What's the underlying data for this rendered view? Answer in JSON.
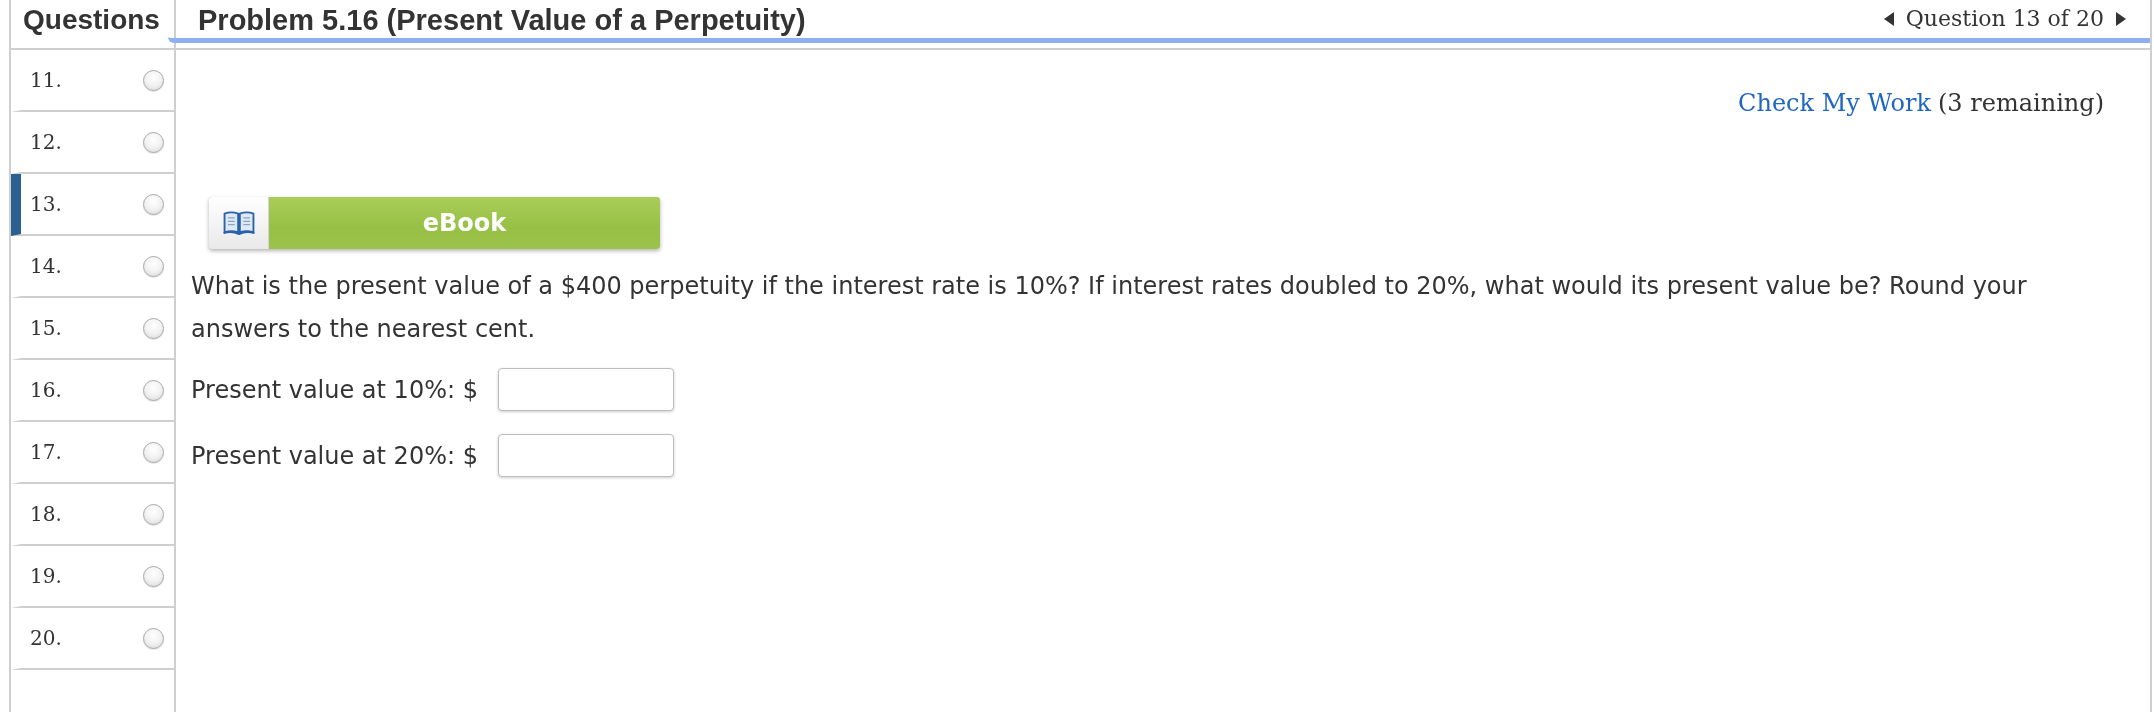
{
  "sidebar": {
    "title": "Questions",
    "items": [
      {
        "number": "11.",
        "selected": false
      },
      {
        "number": "12.",
        "selected": false
      },
      {
        "number": "13.",
        "selected": true
      },
      {
        "number": "14.",
        "selected": false
      },
      {
        "number": "15.",
        "selected": false
      },
      {
        "number": "16.",
        "selected": false
      },
      {
        "number": "17.",
        "selected": false
      },
      {
        "number": "18.",
        "selected": false
      },
      {
        "number": "19.",
        "selected": false
      },
      {
        "number": "20.",
        "selected": false
      }
    ]
  },
  "header": {
    "title": "Problem 5.16 (Present Value of a Perpetuity)",
    "pager": {
      "label": "Question 13 of 20"
    }
  },
  "check_work": {
    "link": "Check My Work",
    "remaining": "(3 remaining)"
  },
  "ebook": {
    "label": "eBook"
  },
  "question": {
    "text": "What is the present value of a $400 perpetuity if the interest rate is 10%? If interest rates doubled to 20%, what would its present value be? Round your answers to the nearest cent.",
    "fields": [
      {
        "label": "Present value at 10%: $"
      },
      {
        "label": "Present value at 20%: $"
      }
    ]
  }
}
